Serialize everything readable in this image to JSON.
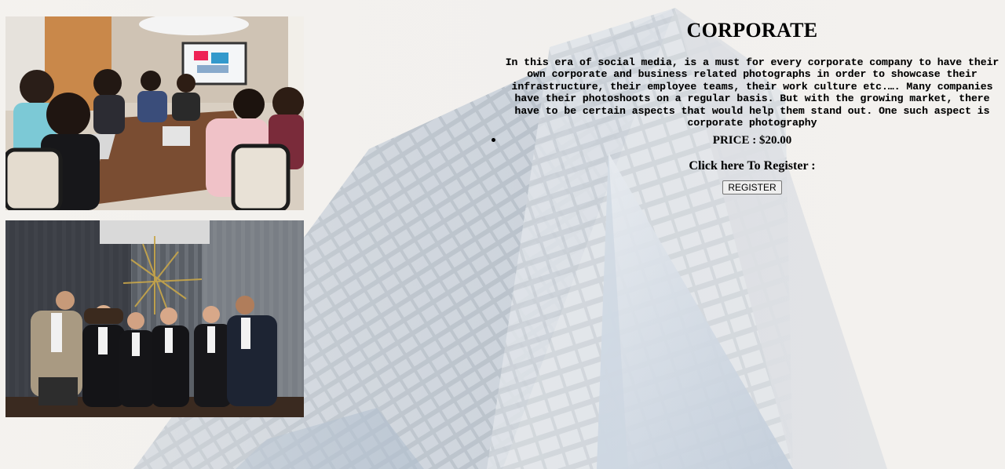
{
  "page": {
    "title": "CORPORATE",
    "description": "In this era of social media, is a must for every corporate company to have their own corporate and business related photographs in order to showcase their infrastructure, their employee teams, their work culture etc.…. Many companies have their photoshoots on a regular basis. But with the growing market, there have to be certain aspects that would help them stand out. One such aspect is corporate photography",
    "price": "PRICE : $20.00",
    "register_label": "Click here To Register :",
    "register_button": "REGISTER"
  },
  "images": {
    "background": "skyscraper-photo",
    "photo_1": "team-meeting-photo",
    "photo_2": "corporate-team-portrait-photo"
  }
}
